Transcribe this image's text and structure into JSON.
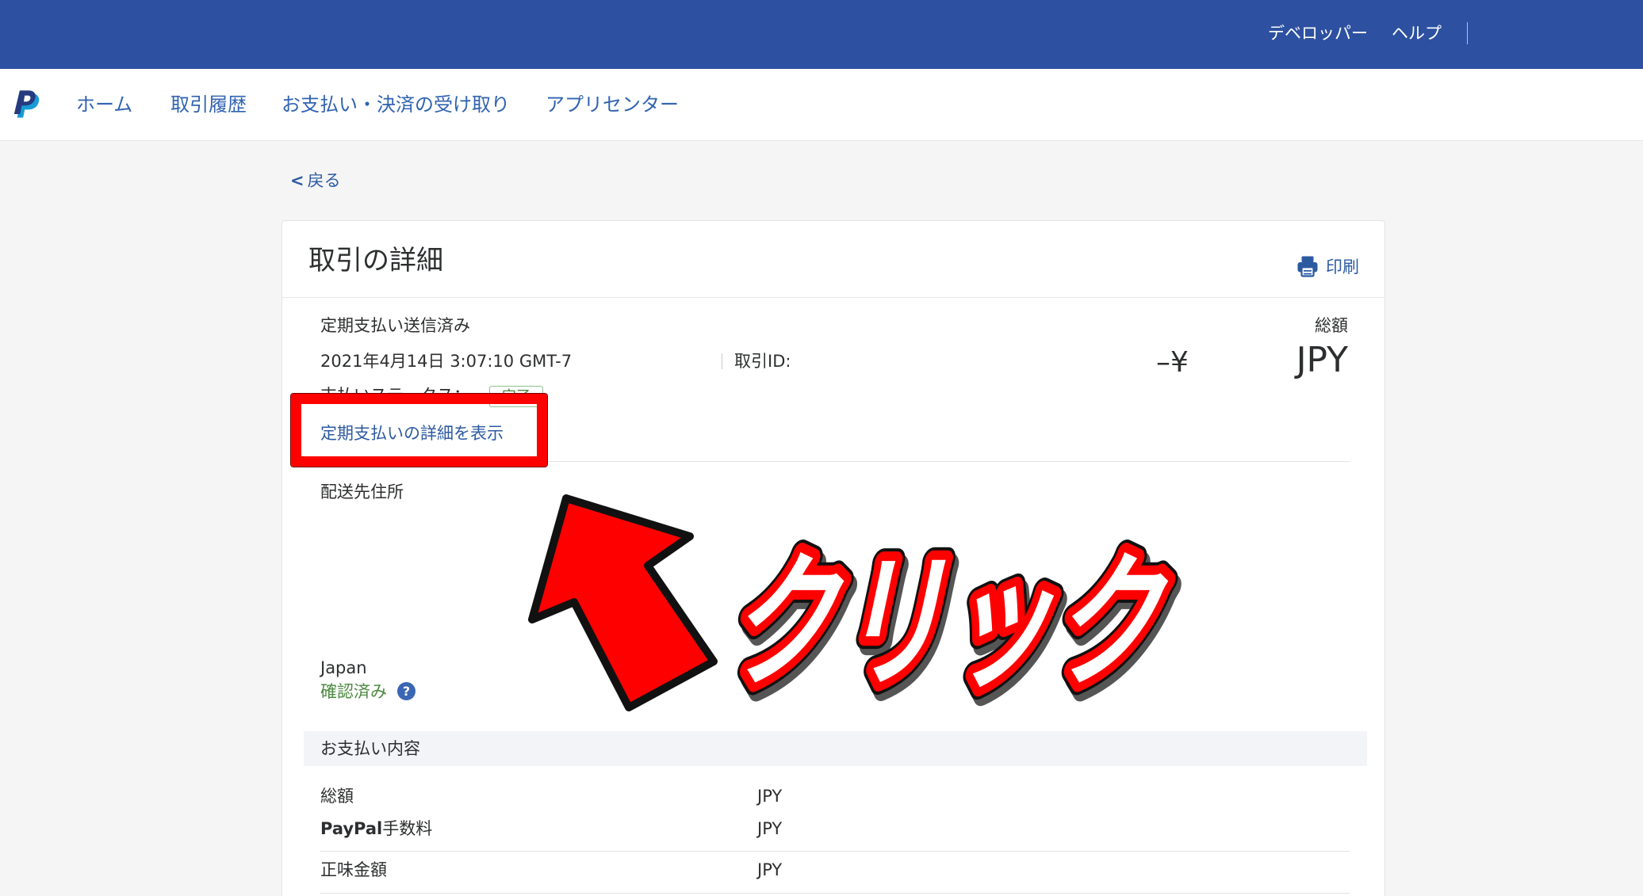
{
  "topbar": {
    "links": [
      {
        "label": "デベロッパー"
      },
      {
        "label": "ヘルプ"
      }
    ]
  },
  "nav": {
    "items": [
      {
        "label": "ホーム"
      },
      {
        "label": "取引履歴"
      },
      {
        "label": "お支払い・決済の受け取り"
      },
      {
        "label": "アプリセンター"
      }
    ]
  },
  "back": {
    "chevron": "<",
    "label": "戻る"
  },
  "card": {
    "title": "取引の詳細",
    "print_label": "印刷"
  },
  "summary": {
    "type": "定期支払い送信済み",
    "total_label": "総額",
    "date": "2021年4月14日 3:07:10 GMT-7",
    "transaction_id_label": "取引ID:",
    "amount_sign": "–¥",
    "currency": "JPY",
    "status_label": "支払いステータス：",
    "status_badge": "完了"
  },
  "recurring_link": "定期支払いの詳細を表示",
  "shipping": {
    "label": "配送先住所",
    "country": "Japan",
    "verified": "確認済み",
    "help": "?"
  },
  "payment": {
    "header": "お支払い内容",
    "rows": [
      {
        "label": "総額",
        "value": "JPY"
      },
      {
        "label_bold": "PayPal",
        "label": "手数料",
        "value": "JPY"
      },
      {
        "label": "正味金額",
        "value": "JPY"
      }
    ]
  },
  "annotation": {
    "callout": "クリック",
    "color": "#ff0000"
  },
  "colors": {
    "topbar": "#2d51a0",
    "link": "#2c5aa0",
    "verified": "#4b8a3f",
    "annotation_red": "#ff0000"
  },
  "icons": {
    "logo": "paypal-logo-icon",
    "print": "printer-icon",
    "help": "question-circle-icon",
    "arrow": "arrow-up-left-icon"
  }
}
